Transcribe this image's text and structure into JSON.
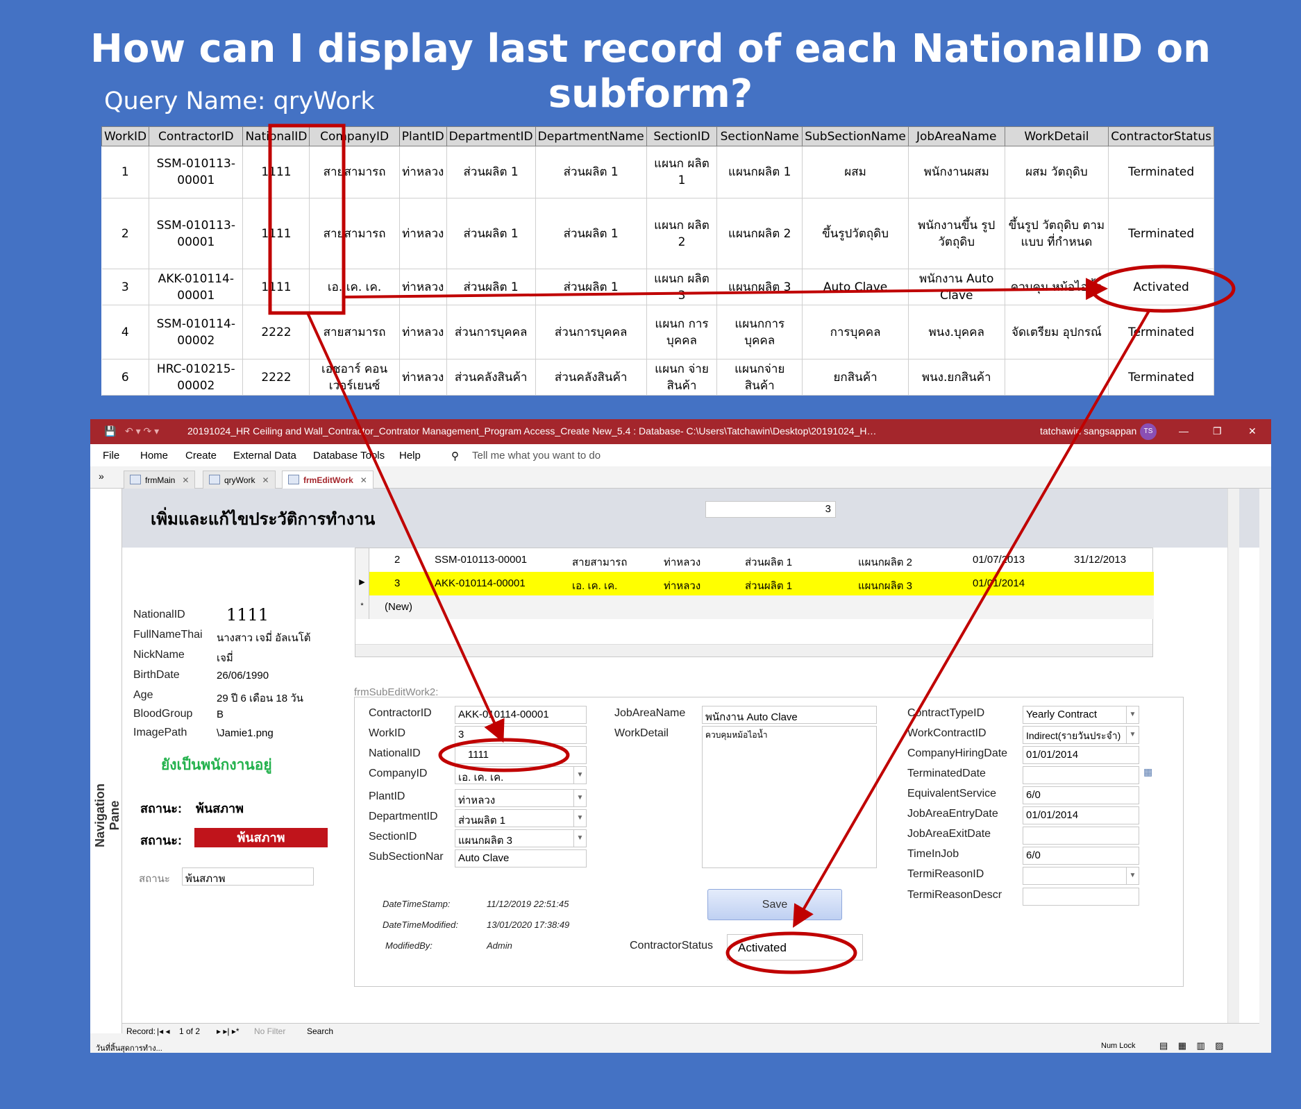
{
  "slide": {
    "title": "How can I display last record of each NationalID on subform?",
    "query_name": "Query Name: qryWork"
  },
  "query_table": {
    "headers": [
      "WorkID",
      "ContractorID",
      "NationalID",
      "CompanyID",
      "PlantID",
      "DepartmentID",
      "DepartmentName",
      "SectionID",
      "SectionName",
      "SubSectionName",
      "JobAreaName",
      "WorkDetail",
      "ContractorStatus"
    ],
    "rows": [
      [
        "1",
        "SSM-010113-00001",
        "1111",
        "สายสามารถ",
        "ท่าหลวง",
        "ส่วนผลิต 1",
        "ส่วนผลิต 1",
        "แผนก ผลิต 1",
        "แผนกผลิต 1",
        "ผสม",
        "พนักงานผสม",
        "ผสม วัตถุดิบ",
        "Terminated"
      ],
      [
        "2",
        "SSM-010113-00001",
        "1111",
        "สายสามารถ",
        "ท่าหลวง",
        "ส่วนผลิต 1",
        "ส่วนผลิต 1",
        "แผนก ผลิต 2",
        "แผนกผลิต 2",
        "ขึ้นรูปวัตถุดิบ",
        "พนักงานขึ้น รูปวัตถุดิบ",
        "ขึ้นรูป วัตถุดิบ ตามแบบ ที่กำหนด",
        "Terminated"
      ],
      [
        "3",
        "AKK-010114-00001",
        "1111",
        "เอ. เค. เค.",
        "ท่าหลวง",
        "ส่วนผลิต 1",
        "ส่วนผลิต 1",
        "แผนก ผลิต 3",
        "แผนกผลิต 3",
        "Auto Clave",
        "พนักงาน Auto Clave",
        "ควบคุม หม้อไอน้ำ",
        "Activated"
      ],
      [
        "4",
        "SSM-010114-00002",
        "2222",
        "สายสามารถ",
        "ท่าหลวง",
        "ส่วนการบุคคล",
        "ส่วนการบุคคล",
        "แผนก การบุคคล",
        "แผนกการ บุคคล",
        "การบุคคล",
        "พนง.บุคคล",
        "จัดเตรียม อุปกรณ์",
        "Terminated"
      ],
      [
        "6",
        "HRC-010215-00002",
        "2222",
        "เอชอาร์ คอนเวอร์เยนซ์",
        "ท่าหลวง",
        "ส่วนคลังสินค้า",
        "ส่วนคลังสินค้า",
        "แผนก จ่ายสินค้า",
        "แผนกจ่าย สินค้า",
        "ยกสินค้า",
        "พนง.ยกสินค้า",
        "",
        "Terminated"
      ]
    ]
  },
  "window": {
    "title": "20191024_HR Ceiling and Wall_Contractor_Contrator Management_Program Access_Create New_5.4 : Database- C:\\Users\\Tatchawin\\Desktop\\20191024_HR Ceiling and Wall_Contractor_Contrator Ma...",
    "user": "tatchawin sangsappan",
    "user_initials": "TS",
    "ribbon": [
      "File",
      "Home",
      "Create",
      "External Data",
      "Database Tools",
      "Help"
    ],
    "tell_me": "Tell me what you want to do",
    "tabs": [
      "frmMain",
      "qryWork",
      "frmEditWork"
    ],
    "nav_pane_label": "Navigation Pane"
  },
  "form": {
    "title": "เพิ่มและแก้ไขประวัติการทำงาน",
    "counter": "3",
    "datasheet": [
      {
        "id": "2",
        "contractor": "SSM-010113-00001",
        "company": "สายสามารถ",
        "plant": "ท่าหลวง",
        "dept": "ส่วนผลิต 1",
        "section": "แผนกผลิต 2",
        "start": "01/07/2013",
        "end": "31/12/2013"
      },
      {
        "id": "3",
        "contractor": "AKK-010114-00001",
        "company": "เอ. เค. เค.",
        "plant": "ท่าหลวง",
        "dept": "ส่วนผลิต 1",
        "section": "แผนกผลิต 3",
        "start": "01/01/2014",
        "end": ""
      }
    ],
    "new_row": "(New)",
    "person": {
      "national_id_label": "NationalID",
      "national_id": "1111",
      "fullname_label": "FullNameThai",
      "fullname": "นางสาว เจมี่ อัลเนโต้",
      "nickname_label": "NickName",
      "nickname": "เจมี่",
      "birthdate_label": "BirthDate",
      "birthdate": "26/06/1990",
      "age_label": "Age",
      "age": "29 ปี 6 เดือน 18 วัน",
      "blood_label": "BloodGroup",
      "blood": "B",
      "image_label": "ImagePath",
      "image": "\\Jamie1.png",
      "still_employed": "ยังเป็นพนักงานอยู่",
      "status_label_1": "สถานะ:",
      "status_value_1": "พ้นสภาพ",
      "status_label_2": "สถานะ:",
      "status_value_2": "พ้นสภาพ",
      "status_label_3": "สถานะ",
      "status_value_3": "พ้นสภาพ"
    },
    "subform_caption": "frmSubEditWork2:",
    "sub": {
      "contractor_label": "ContractorID",
      "contractor": "AKK-010114-00001",
      "work_label": "WorkID",
      "work": "3",
      "national_label": "NationalID",
      "national": "1111",
      "company_label": "CompanyID",
      "company": "เอ. เค. เค.",
      "plant_label": "PlantID",
      "plant": "ท่าหลวง",
      "dept_label": "DepartmentID",
      "dept": "ส่วนผลิต 1",
      "section_label": "SectionID",
      "section": "แผนกผลิต 3",
      "subsection_label": "SubSectionNar",
      "subsection": "Auto Clave",
      "jobarea_label": "JobAreaName",
      "jobarea": "พนักงาน Auto Clave",
      "workdetail_label": "WorkDetail",
      "workdetail": "ควบคุมหม้อไอน้ำ",
      "contracttype_label": "ContractTypeID",
      "contracttype": "Yearly Contract",
      "workcontract_label": "WorkContractID",
      "workcontract": "Indirect(รายวันประจำ)",
      "hiring_label": "CompanyHiringDate",
      "hiring": "01/01/2014",
      "terminated_label": "TerminatedDate",
      "terminated": "",
      "equivalent_label": "EquivalentService",
      "equivalent": "6/0",
      "entry_label": "JobAreaEntryDate",
      "entry": "01/01/2014",
      "exit_label": "JobAreaExitDate",
      "exit": "",
      "timeinjob_label": "TimeInJob",
      "timeinjob": "6/0",
      "reason_label": "TermiReasonID",
      "reason": "",
      "reasondesc_label": "TermiReasonDescr",
      "reasondesc": "",
      "stamp_label": "DateTimeStamp:",
      "stamp": "11/12/2019 22:51:45",
      "modified_label": "DateTimeModified:",
      "modified": "13/01/2020 17:38:49",
      "modby_label": "ModifiedBy:",
      "modby": "Admin",
      "save": "Save",
      "status_label": "ContractorStatus",
      "status": "Activated"
    }
  },
  "record_nav": {
    "label": "Record:",
    "position": "1 of 2",
    "filter": "No Filter",
    "search": "Search"
  },
  "status_bar": {
    "left": "วันที่สิ้นสุดการทำง...",
    "numlock": "Num Lock"
  },
  "colors": {
    "background": "#4472c4",
    "titlebar": "#a4262c",
    "annotation": "#c00000",
    "highlight": "#ffff00"
  }
}
